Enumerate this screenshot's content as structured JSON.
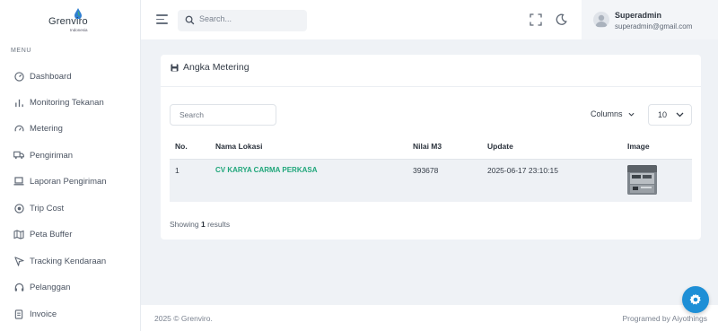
{
  "brand": {
    "name": "Grenviro",
    "sub": "Indonesia"
  },
  "sidebar": {
    "menu_label": "MENU",
    "items": [
      {
        "label": "Dashboard",
        "icon": "dashboard-icon"
      },
      {
        "label": "Monitoring Tekanan",
        "icon": "bar-chart-icon"
      },
      {
        "label": "Metering",
        "icon": "gauge-icon"
      },
      {
        "label": "Pengiriman",
        "icon": "truck-icon"
      },
      {
        "label": "Laporan Pengiriman",
        "icon": "laptop-icon"
      },
      {
        "label": "Trip Cost",
        "icon": "coin-icon"
      },
      {
        "label": "Peta Buffer",
        "icon": "map-icon"
      },
      {
        "label": "Tracking Kendaraan",
        "icon": "navigation-icon"
      },
      {
        "label": "Pelanggan",
        "icon": "headset-icon"
      },
      {
        "label": "Invoice",
        "icon": "document-icon"
      }
    ]
  },
  "header": {
    "search_placeholder": "Search...",
    "user": {
      "name": "Superadmin",
      "email": "superadmin@gmail.com"
    }
  },
  "card": {
    "title": "Angka Metering",
    "search_placeholder": "Search",
    "columns_label": "Columns",
    "page_size": "10",
    "columns": [
      "No.",
      "Nama Lokasi",
      "Nilai M3",
      "Update",
      "Image"
    ],
    "rows": [
      {
        "no": "1",
        "lokasi": "CV KARYA CARMA PERKASA",
        "nilai": "393678",
        "update": "2025-06-17 23:10:15"
      }
    ],
    "showing_prefix": "Showing",
    "showing_count": "1",
    "showing_suffix": "results"
  },
  "footer": {
    "copyright": "2025 © Grenviro.",
    "credit": "Programed by Aiyothings"
  },
  "colors": {
    "accent": "#1e8fd6",
    "link": "#1fa67a",
    "background": "#eff2f6"
  }
}
